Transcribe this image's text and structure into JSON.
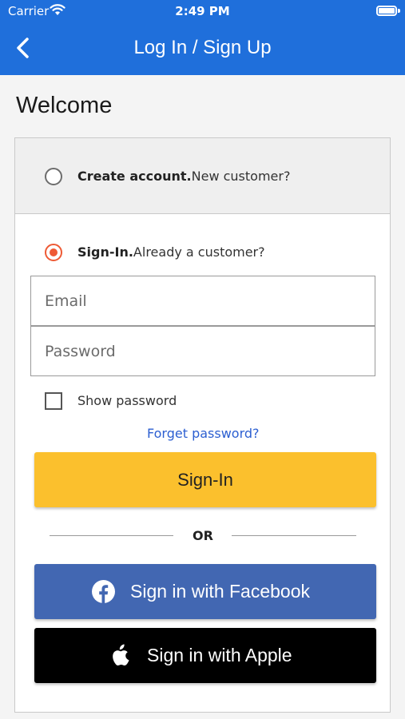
{
  "status_bar": {
    "carrier": "Carrier",
    "time": "2:49 PM"
  },
  "nav": {
    "title": "Log In / Sign Up",
    "back_icon": "chevron-left-icon"
  },
  "page": {
    "heading": "Welcome"
  },
  "create_account": {
    "bold": "Create account.",
    "text": "New customer?",
    "selected": false
  },
  "sign_in_option": {
    "bold": "Sign-In.",
    "text": "Already a customer?",
    "selected": true
  },
  "form": {
    "email_placeholder": "Email",
    "password_placeholder": "Password",
    "show_password_label": "Show password",
    "forgot_label": "Forget password?",
    "signin_label": "Sign-In"
  },
  "divider": {
    "or_label": "OR"
  },
  "social": {
    "facebook_label": "Sign in with Facebook",
    "apple_label": "Sign in with Apple"
  },
  "colors": {
    "nav_bg": "#1f6fdb",
    "radio_selected": "#ee5a35",
    "signin_button": "#fbc02d",
    "facebook_button": "#4267b2",
    "apple_button": "#000000",
    "link": "#2c5fd1"
  }
}
